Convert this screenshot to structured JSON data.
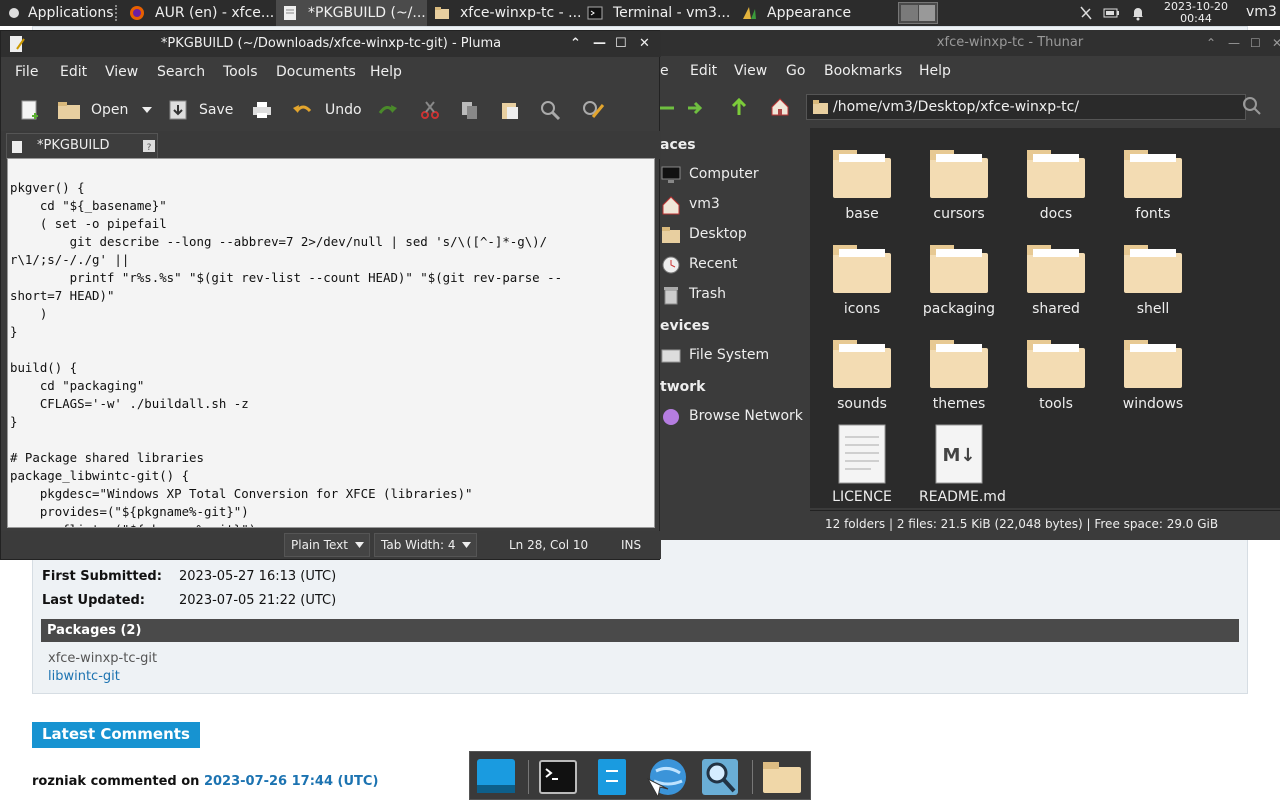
{
  "panel": {
    "applications": "Applications",
    "tasks": [
      {
        "label": "AUR (en) - xfce...",
        "active": false
      },
      {
        "label": "*PKGBUILD (~/...",
        "active": true
      },
      {
        "label": "xfce-winxp-tc - ...",
        "active": false
      },
      {
        "label": "Terminal - vm3...",
        "active": false
      },
      {
        "label": "Appearance",
        "active": false
      }
    ],
    "clock_date": "2023-10-20",
    "clock_time": "00:44",
    "user": "vm3"
  },
  "aur": {
    "first_submitted_label": "First Submitted:",
    "first_submitted_value": "2023-05-27 16:13 (UTC)",
    "last_updated_label": "Last Updated:",
    "last_updated_value": "2023-07-05 21:22 (UTC)",
    "packages_header": "Packages (2)",
    "packages": [
      "xfce-winxp-tc-git",
      "libwintc-git"
    ],
    "latest_comments": "Latest Comments",
    "comment_author": "rozniak commented on ",
    "comment_date": "2023-07-26 17:44 (UTC)"
  },
  "thunar": {
    "title": "xfce-winxp-tc - Thunar",
    "menu": [
      "e",
      "Edit",
      "View",
      "Go",
      "Bookmarks",
      "Help"
    ],
    "location": "/home/vm3/Desktop/xfce-winxp-tc/",
    "sidebar": {
      "places_header": "aces",
      "places": [
        "Computer",
        "vm3",
        "Desktop",
        "Recent",
        "Trash"
      ],
      "devices_header": "evices",
      "devices": [
        "File System"
      ],
      "network_header": "twork",
      "network": [
        "Browse Network"
      ]
    },
    "folders": [
      "base",
      "cursors",
      "docs",
      "fonts",
      "icons",
      "packaging",
      "shared",
      "shell",
      "sounds",
      "themes",
      "tools",
      "windows"
    ],
    "files": [
      "LICENCE",
      "README.md"
    ],
    "status": "12 folders  |  2 files: 21.5 KiB (22,048 bytes)  |  Free space: 29.0 GiB"
  },
  "pluma": {
    "title": "*PKGBUILD (~/Downloads/xfce-winxp-tc-git) - Pluma",
    "menu": [
      "File",
      "Edit",
      "View",
      "Search",
      "Tools",
      "Documents",
      "Help"
    ],
    "toolbar": {
      "open": "Open",
      "save": "Save",
      "undo": "Undo"
    },
    "tab_label": "*PKGBUILD",
    "code": "pkgver() {\n    cd \"${_basename}\"\n    ( set -o pipefail\n        git describe --long --abbrev=7 2>/dev/null | sed 's/\\([^-]*-g\\)/\nr\\1/;s/-/./g' ||\n        printf \"r%s.%s\" \"$(git rev-list --count HEAD)\" \"$(git rev-parse --\nshort=7 HEAD)\"\n    )\n}\n\nbuild() {\n    cd \"packaging\"\n    CFLAGS='-w' ./buildall.sh -z\n}\n\n# Package shared libraries\npackage_libwintc-git() {\n    pkgdesc=\"Windows XP Total Conversion for XFCE (libraries)\"\n    provides=(\"${pkgname%-git}\")\n    conflicts=(\"${pkgname%-git}\")",
    "status": {
      "syntax": "Plain Text",
      "tab_width": "Tab Width:  4",
      "position": "Ln 28, Col 10",
      "mode": "INS"
    }
  }
}
